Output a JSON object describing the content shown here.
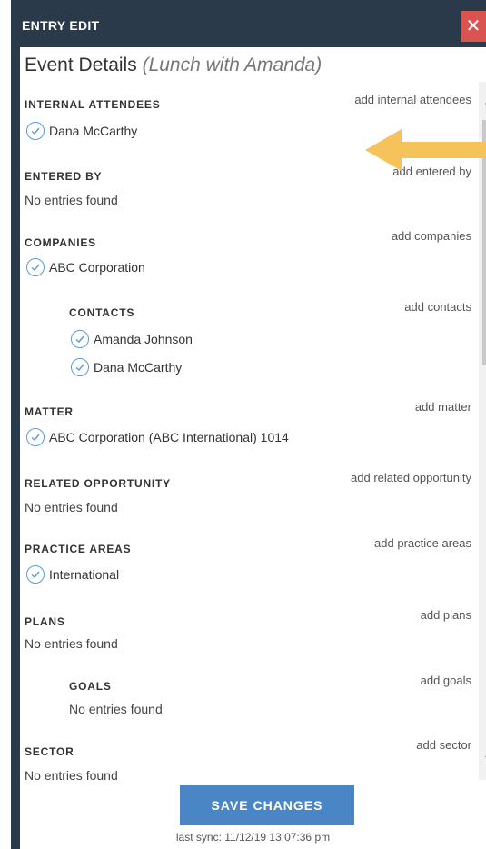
{
  "window": {
    "title": "ENTRY EDIT",
    "close_label": "✕"
  },
  "header": {
    "title": "Event Details",
    "subtitle": "(Lunch with Amanda)"
  },
  "sections": {
    "internal_attendees": {
      "title": "INTERNAL ATTENDEES",
      "add_label": "add internal attendees",
      "items": [
        "Dana McCarthy"
      ]
    },
    "entered_by": {
      "title": "ENTERED BY",
      "add_label": "add entered by",
      "empty": "No entries found"
    },
    "companies": {
      "title": "COMPANIES",
      "add_label": "add companies",
      "items": [
        "ABC Corporation"
      ]
    },
    "contacts": {
      "title": "CONTACTS",
      "add_label": "add contacts",
      "items": [
        "Amanda Johnson",
        "Dana McCarthy"
      ]
    },
    "matter": {
      "title": "MATTER",
      "add_label": "add matter",
      "items": [
        "ABC Corporation (ABC International) 1014"
      ]
    },
    "related_opportunity": {
      "title": "RELATED OPPORTUNITY",
      "add_label": "add related opportunity",
      "empty": "No entries found"
    },
    "practice_areas": {
      "title": "PRACTICE AREAS",
      "add_label": "add practice areas",
      "items": [
        "International"
      ]
    },
    "plans": {
      "title": "PLANS",
      "add_label": "add plans",
      "empty": "No entries found"
    },
    "goals": {
      "title": "GOALS",
      "add_label": "add goals",
      "empty": "No entries found"
    },
    "sector": {
      "title": "SECTOR",
      "add_label": "add sector",
      "empty": "No entries found"
    }
  },
  "footer": {
    "save_label": "SAVE CHANGES",
    "sync_text": "last sync: 11/12/19 13:07:36 pm"
  },
  "colors": {
    "titlebar": "#2a3a4b",
    "close": "#d9534f",
    "save_button": "#4a86c5",
    "check": "#5a9bd5",
    "arrow": "#f6c35a"
  }
}
